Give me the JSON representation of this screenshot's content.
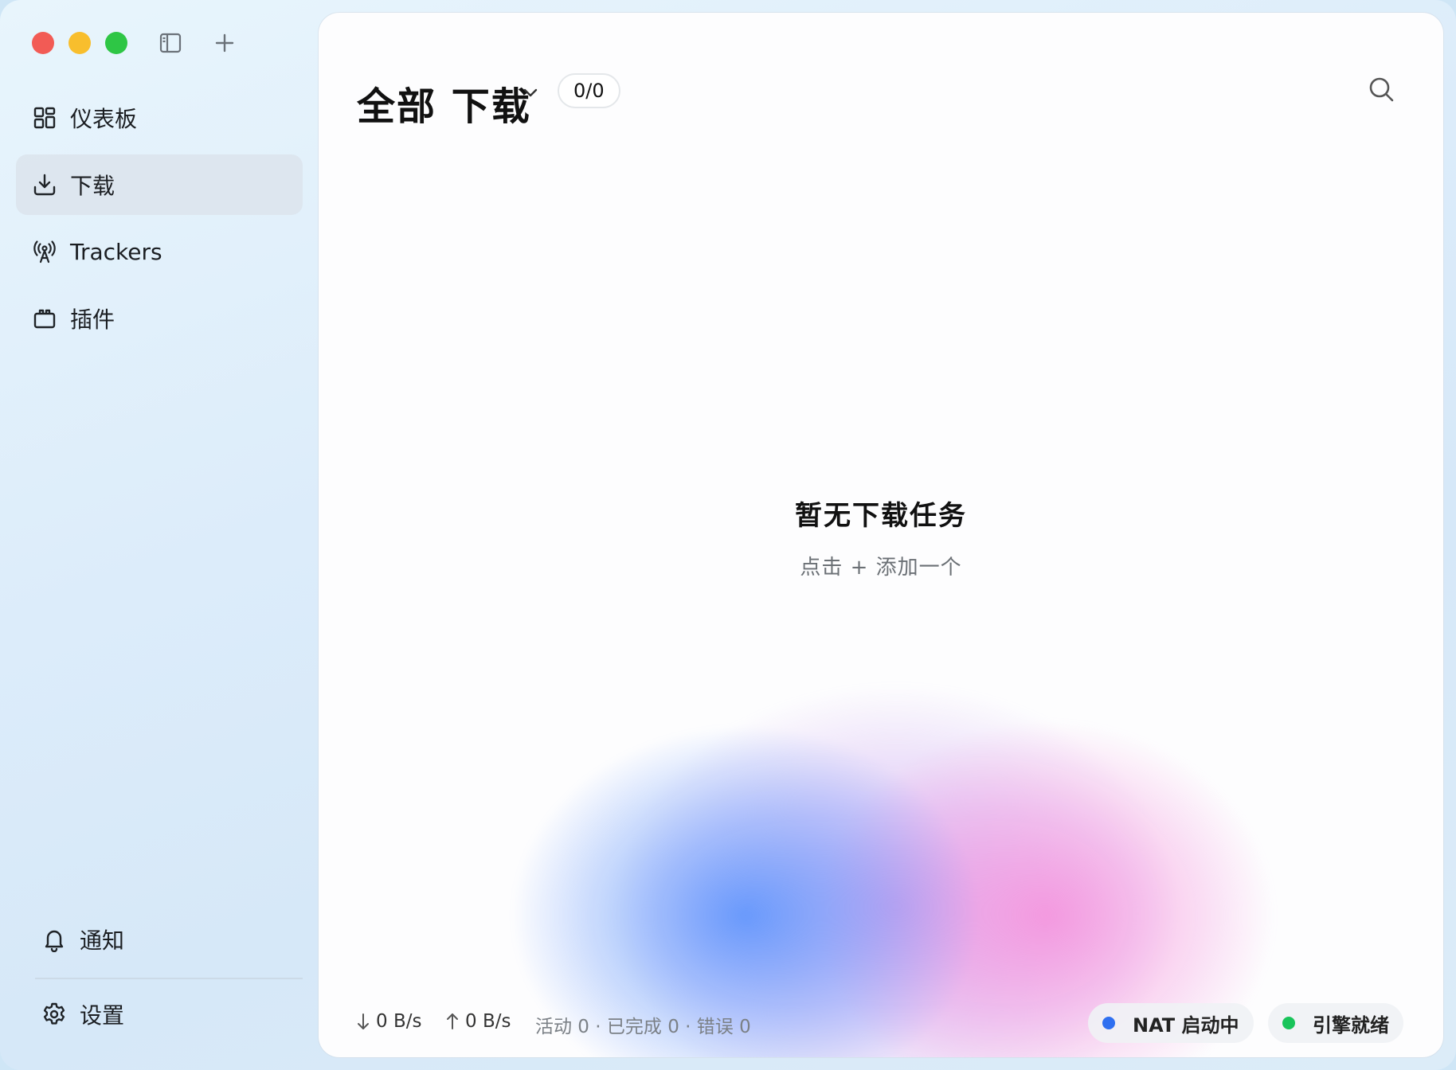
{
  "sidebar": {
    "items": [
      {
        "label": "仪表板",
        "icon": "dashboard-icon"
      },
      {
        "label": "下载",
        "icon": "download-icon",
        "active": true
      },
      {
        "label": "Trackers",
        "icon": "broadcast-icon"
      },
      {
        "label": "插件",
        "icon": "plugin-icon"
      }
    ],
    "bottom": [
      {
        "label": "通知",
        "icon": "bell-icon"
      },
      {
        "label": "设置",
        "icon": "gear-icon"
      }
    ]
  },
  "header": {
    "title": "全部 下载",
    "count": "0/0"
  },
  "empty": {
    "title": "暂无下载任务",
    "subtitle": "点击 + 添加一个"
  },
  "status": {
    "down_speed": "0 B/s",
    "up_speed": "0 B/s",
    "counts": "活动 0 · 已完成 0 · 错误 0",
    "nat": {
      "label": "NAT 启动中",
      "color": "#2f6ff0"
    },
    "engine": {
      "label": "引擎就绪",
      "color": "#19c45a"
    }
  },
  "colors": {
    "close": "#f25b55",
    "minimize": "#f8be2d",
    "maximize": "#2ec645"
  }
}
